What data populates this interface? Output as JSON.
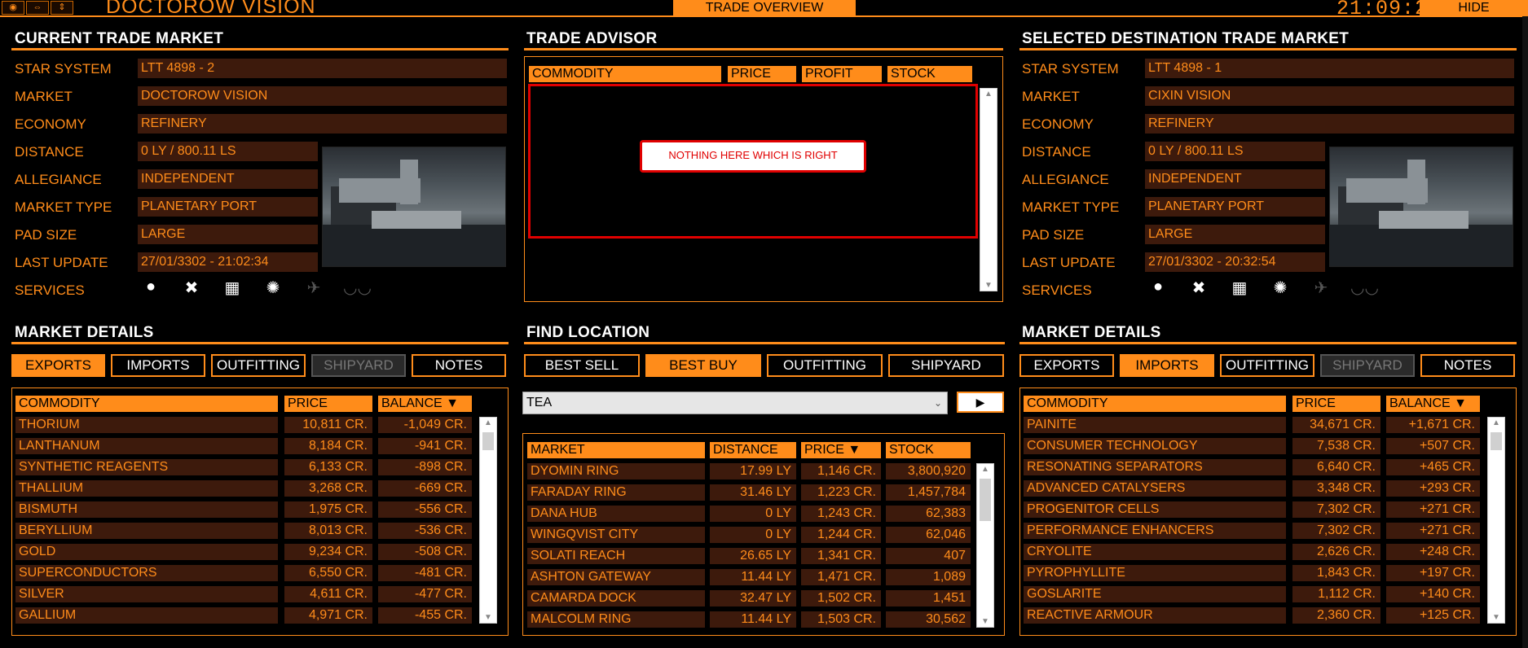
{
  "topbar": {
    "icons": [
      "eye-icon",
      "resize-horizontal-icon",
      "resize-vertical-icon"
    ],
    "icon_glyphs": [
      "◉",
      "⇔",
      "⇕"
    ],
    "title": "DOCTOROW VISION",
    "trade_overview": "TRADE OVERVIEW",
    "clock": "21:09:2",
    "hide": "HIDE"
  },
  "current": {
    "title": "CURRENT TRADE MARKET",
    "labels": [
      "STAR SYSTEM",
      "MARKET",
      "ECONOMY",
      "DISTANCE",
      "ALLEGIANCE",
      "MARKET TYPE",
      "PAD SIZE",
      "LAST UPDATE",
      "SERVICES"
    ],
    "values": [
      "LTT 4898 - 2",
      "DOCTOROW VISION",
      "REFINERY",
      "0 LY / 800.11 LS",
      "INDEPENDENT",
      "PLANETARY PORT",
      "LARGE",
      "27/01/3302 - 21:02:34"
    ],
    "services": [
      "droplet-icon",
      "tools-icon",
      "market-icon",
      "gear-icon",
      "ship-icon",
      "glasses-icon"
    ],
    "service_glyphs": [
      "●",
      "✖",
      "▦",
      "✺",
      "✈",
      "◡◡"
    ]
  },
  "destination": {
    "title": "SELECTED DESTINATION TRADE MARKET",
    "labels": [
      "STAR SYSTEM",
      "MARKET",
      "ECONOMY",
      "DISTANCE",
      "ALLEGIANCE",
      "MARKET TYPE",
      "PAD SIZE",
      "LAST UPDATE",
      "SERVICES"
    ],
    "values": [
      "LTT 4898 - 1",
      "CIXIN VISION",
      "REFINERY",
      "0 LY / 800.11 LS",
      "INDEPENDENT",
      "PLANETARY PORT",
      "LARGE",
      "27/01/3302 - 20:32:54"
    ],
    "services": [
      "droplet-icon",
      "tools-icon",
      "market-icon",
      "gear-icon",
      "ship-icon",
      "glasses-icon"
    ],
    "service_glyphs": [
      "●",
      "✖",
      "▦",
      "✺",
      "✈",
      "◡◡"
    ]
  },
  "advisor": {
    "title": "TRADE ADVISOR",
    "headers": [
      "COMMODITY",
      "PRICE",
      "PROFIT",
      "STOCK"
    ],
    "message": "NOTHING  HERE  WHICH  IS  RIGHT"
  },
  "find": {
    "title": "FIND LOCATION",
    "tabs": [
      "BEST SELL",
      "BEST BUY",
      "OUTFITTING",
      "SHIPYARD"
    ],
    "active_tab": 1,
    "commodity": "TEA",
    "go": "▶",
    "headers": [
      "MARKET",
      "DISTANCE",
      "PRICE ▼",
      "STOCK"
    ],
    "rows": [
      [
        "DYOMIN RING",
        "17.99 LY",
        "1,146 CR.",
        "3,800,920"
      ],
      [
        "FARADAY RING",
        "31.46 LY",
        "1,223 CR.",
        "1,457,784"
      ],
      [
        "DANA HUB",
        "0 LY",
        "1,243 CR.",
        "62,383"
      ],
      [
        "WINGQVIST CITY",
        "0 LY",
        "1,244 CR.",
        "62,046"
      ],
      [
        "SOLATI REACH",
        "26.65 LY",
        "1,341 CR.",
        "407"
      ],
      [
        "ASHTON GATEWAY",
        "11.44 LY",
        "1,471 CR.",
        "1,089"
      ],
      [
        "CAMARDA DOCK",
        "32.47 LY",
        "1,502 CR.",
        "1,451"
      ],
      [
        "MALCOLM RING",
        "11.44 LY",
        "1,503 CR.",
        "30,562"
      ]
    ]
  },
  "left_details": {
    "title": "MARKET DETAILS",
    "tabs": [
      "EXPORTS",
      "IMPORTS",
      "OUTFITTING",
      "SHIPYARD",
      "NOTES"
    ],
    "headers": [
      "COMMODITY",
      "PRICE",
      "BALANCE ▼"
    ],
    "rows": [
      [
        "THORIUM",
        "10,811 CR.",
        "-1,049 CR."
      ],
      [
        "LANTHANUM",
        "8,184 CR.",
        "-941 CR."
      ],
      [
        "SYNTHETIC REAGENTS",
        "6,133 CR.",
        "-898 CR."
      ],
      [
        "THALLIUM",
        "3,268 CR.",
        "-669 CR."
      ],
      [
        "BISMUTH",
        "1,975 CR.",
        "-556 CR."
      ],
      [
        "BERYLLIUM",
        "8,013 CR.",
        "-536 CR."
      ],
      [
        "GOLD",
        "9,234 CR.",
        "-508 CR."
      ],
      [
        "SUPERCONDUCTORS",
        "6,550 CR.",
        "-481 CR."
      ],
      [
        "SILVER",
        "4,611 CR.",
        "-477 CR."
      ],
      [
        "GALLIUM",
        "4,971 CR.",
        "-455 CR."
      ]
    ]
  },
  "right_details": {
    "title": "MARKET DETAILS",
    "tabs": [
      "EXPORTS",
      "IMPORTS",
      "OUTFITTING",
      "SHIPYARD",
      "NOTES"
    ],
    "headers": [
      "COMMODITY",
      "PRICE",
      "BALANCE ▼"
    ],
    "rows": [
      [
        "PAINITE",
        "34,671 CR.",
        "+1,671 CR."
      ],
      [
        "CONSUMER TECHNOLOGY",
        "7,538 CR.",
        "+507 CR."
      ],
      [
        "RESONATING SEPARATORS",
        "6,640 CR.",
        "+465 CR."
      ],
      [
        "ADVANCED CATALYSERS",
        "3,348 CR.",
        "+293 CR."
      ],
      [
        "PROGENITOR CELLS",
        "7,302 CR.",
        "+271 CR."
      ],
      [
        "PERFORMANCE ENHANCERS",
        "7,302 CR.",
        "+271 CR."
      ],
      [
        "CRYOLITE",
        "2,626 CR.",
        "+248 CR."
      ],
      [
        "PYROPHYLLITE",
        "1,843 CR.",
        "+197 CR."
      ],
      [
        "GOSLARITE",
        "1,112 CR.",
        "+140 CR."
      ],
      [
        "REACTIVE ARMOUR",
        "2,360 CR.",
        "+125 CR."
      ]
    ]
  },
  "colors": {
    "accent": "#ff8c1a",
    "cell": "#3d1a0c",
    "alert": "#e00000"
  }
}
